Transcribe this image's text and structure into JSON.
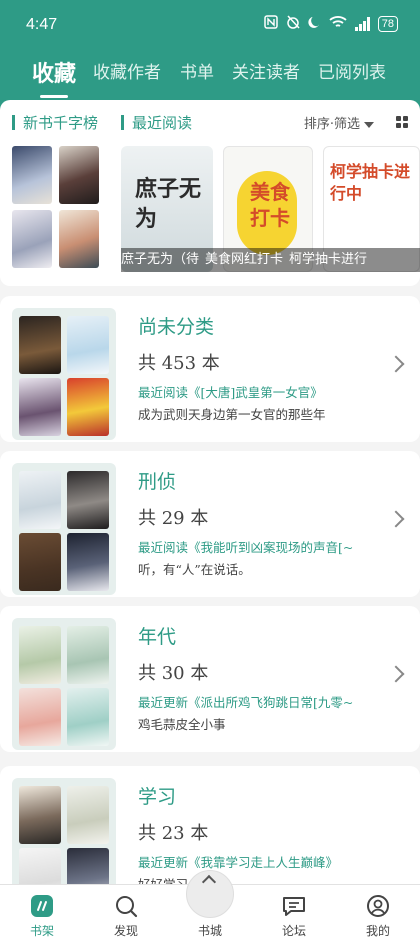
{
  "status_bar": {
    "time": "4:47",
    "battery": "78"
  },
  "tabs": [
    {
      "label": "收藏",
      "active": true
    },
    {
      "label": "收藏作者"
    },
    {
      "label": "书单"
    },
    {
      "label": "关注读者"
    },
    {
      "label": "已阅列表"
    }
  ],
  "top_section": {
    "new_books_label": "新书千字榜",
    "recent_label": "最近阅读",
    "sort_label": "排序·筛选",
    "covers": [
      {
        "title": "庶子无为",
        "caption": "庶子无为（待"
      },
      {
        "title": "美食打卡",
        "caption": "美食网红打卡"
      },
      {
        "title": "柯学抽卡进行中",
        "caption": "柯学抽卡进行"
      }
    ]
  },
  "categories": [
    {
      "name": "尚未分类",
      "count": "共 453 本",
      "recent": "最近阅读《[大唐]武皇第一女官》",
      "desc": "成为武则天身边第一女官的那些年"
    },
    {
      "name": "刑侦",
      "count": "共 29 本",
      "recent": "最近阅读《我能听到凶案现场的声音[~",
      "desc": "听，有“人”在说话。"
    },
    {
      "name": "年代",
      "count": "共 30 本",
      "recent": "最近更新《派出所鸡飞狗跳日常[九零~",
      "desc": "鸡毛蒜皮全小事"
    },
    {
      "name": "学习",
      "count": "共 23 本",
      "recent": "最近更新《我靠学习走上人生巅峰》",
      "desc": "好好学习"
    }
  ],
  "bottom_nav": [
    {
      "label": "书架",
      "active": true
    },
    {
      "label": "发现"
    },
    {
      "label": "书城"
    },
    {
      "label": "论坛"
    },
    {
      "label": "我的"
    }
  ],
  "colors": {
    "primary": "#2e9b86",
    "background": "#f4f4f4"
  }
}
